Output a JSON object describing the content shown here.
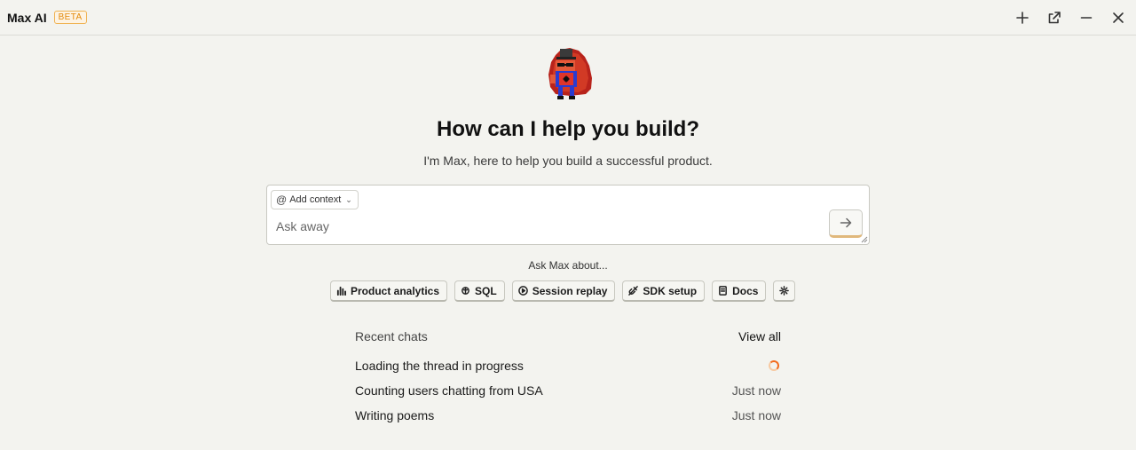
{
  "window": {
    "title": "Max AI",
    "badge": "BETA",
    "controls": [
      "plus-icon",
      "open-external-icon",
      "minimize-icon",
      "close-icon"
    ]
  },
  "hero": {
    "heading": "How can I help you build?",
    "subheading": "I'm Max, here to help you build a successful product."
  },
  "composer": {
    "context_button_label": "Add context",
    "input_placeholder": "Ask away",
    "input_value": ""
  },
  "suggestions": {
    "title": "Ask Max about...",
    "items": [
      {
        "label": "Product analytics",
        "icon": "bar-chart-icon"
      },
      {
        "label": "SQL",
        "icon": "database-icon"
      },
      {
        "label": "Session replay",
        "icon": "play-icon"
      },
      {
        "label": "SDK setup",
        "icon": "plug-icon"
      },
      {
        "label": "Docs",
        "icon": "book-icon"
      },
      {
        "label": "",
        "icon": "gear-icon"
      }
    ]
  },
  "recent": {
    "title": "Recent chats",
    "view_all_label": "View all",
    "chats": [
      {
        "title": "Loading the thread in progress",
        "status": "loading"
      },
      {
        "title": "Counting users chatting from USA",
        "time": "Just now"
      },
      {
        "title": "Writing poems",
        "time": "Just now"
      }
    ]
  },
  "colors": {
    "background": "#f3f3ef",
    "accent": "#f26b1d",
    "beta_badge": "#e38a0a",
    "mascot_red": "#c8281e"
  }
}
